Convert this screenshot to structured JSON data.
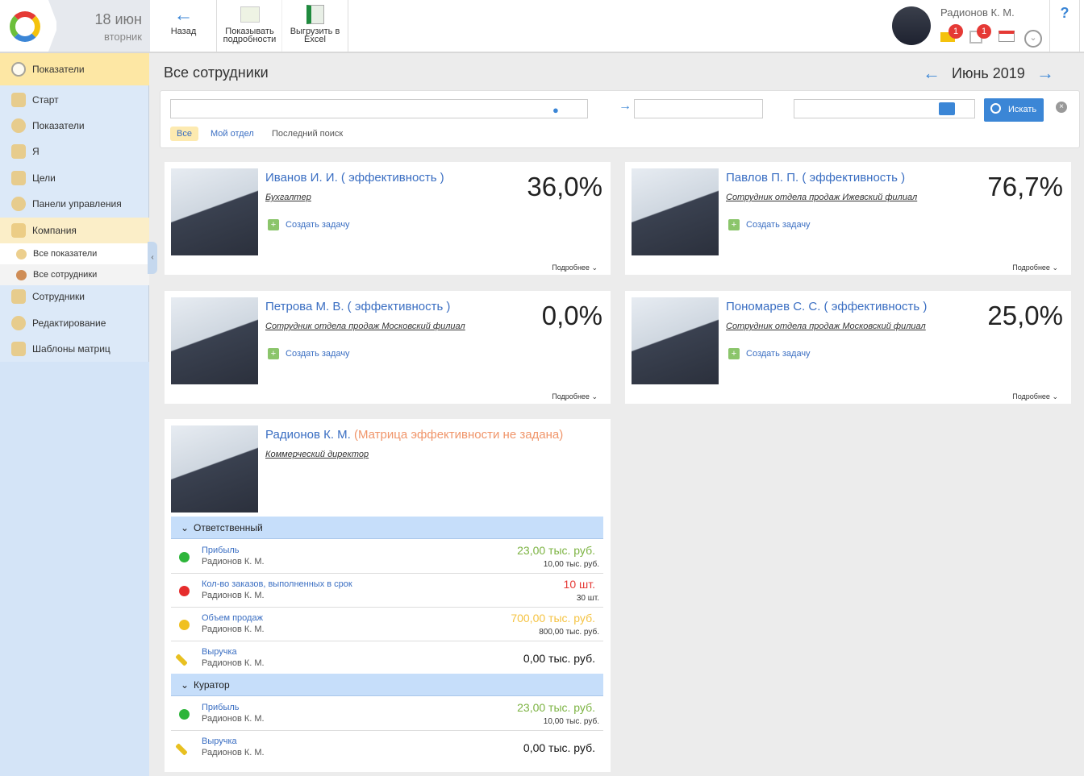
{
  "header": {
    "date": "18 июн",
    "weekday": "вторник",
    "back": "Назад",
    "details": "Показывать подробности",
    "export": "Выгрузить в Excel",
    "user": "Радионов К. М.",
    "mail_count": "1",
    "tasks_count": "1",
    "help": "?"
  },
  "sidebar": {
    "active": "Показатели",
    "items": [
      "Старт",
      "Показатели",
      "Я",
      "Цели",
      "Панели управления",
      "Компания"
    ],
    "subitems": [
      "Все показатели",
      "Все сотрудники"
    ],
    "items2": [
      "Сотрудники",
      "Редактирование",
      "Шаблоны матриц"
    ]
  },
  "page": {
    "title": "Все сотрудники",
    "period": "Июнь 2019",
    "search": "Искать",
    "filters": [
      "Все",
      "Мой отдел",
      "Последний поиск"
    ]
  },
  "cards": [
    {
      "name": "Иванов И. И. ( эффективность )",
      "role": "Бухгалтер",
      "task": "Создать задачу",
      "pct": "36,0%",
      "more": "Подробнее"
    },
    {
      "name": "Павлов П. П. ( эффективность )",
      "role": "Сотрудник отдела продаж Ижевский филиал",
      "task": "Создать задачу",
      "pct": "76,7%",
      "more": "Подробнее"
    },
    {
      "name": "Петрова М. В. ( эффективность )",
      "role": "Сотрудник отдела продаж Московский филиал",
      "task": "Создать задачу",
      "pct": "0,0%",
      "more": "Подробнее"
    },
    {
      "name": "Пономарев С. С. ( эффективность )",
      "role": "Сотрудник отдела продаж Московский филиал",
      "task": "Создать задачу",
      "pct": "25,0%",
      "more": "Подробнее"
    }
  ],
  "big": {
    "name": "Радионов К. М.",
    "note": "(Матрица эффективности не задана)",
    "role": "Коммерческий директор",
    "groups": [
      {
        "label": "Ответственный"
      },
      {
        "label": "Куратор"
      }
    ],
    "rows": [
      {
        "title": "Прибыль",
        "owner": "Радионов К. М.",
        "value": "23,00 тыс. руб.",
        "target": "10,00 тыс. руб.",
        "color": "#7cb342",
        "dot": "#2db53a"
      },
      {
        "title": "Кол-во заказов, выполненных в срок",
        "owner": "Радионов К. М.",
        "value": "10 шт.",
        "target": "30 шт.",
        "color": "#e53935",
        "dot": "#e62d2d"
      },
      {
        "title": "Объем продаж",
        "owner": "Радионов К. М.",
        "value": "700,00 тыс. руб.",
        "target": "800,00 тыс. руб.",
        "color": "#f5c342",
        "dot": "#f0c020"
      },
      {
        "title": "Выручка",
        "owner": "Радионов К. М.",
        "value": "0,00 тыс. руб.",
        "target": "",
        "color": "#111",
        "dot": "#e8c020"
      },
      {
        "title": "Прибыль",
        "owner": "Радионов К. М.",
        "value": "23,00 тыс. руб.",
        "target": "10,00 тыс. руб.",
        "color": "#7cb342",
        "dot": "#2db53a"
      },
      {
        "title": "Выручка",
        "owner": "Радионов К. М.",
        "value": "0,00 тыс. руб.",
        "target": "",
        "color": "#111",
        "dot": "#e8c020"
      }
    ]
  }
}
